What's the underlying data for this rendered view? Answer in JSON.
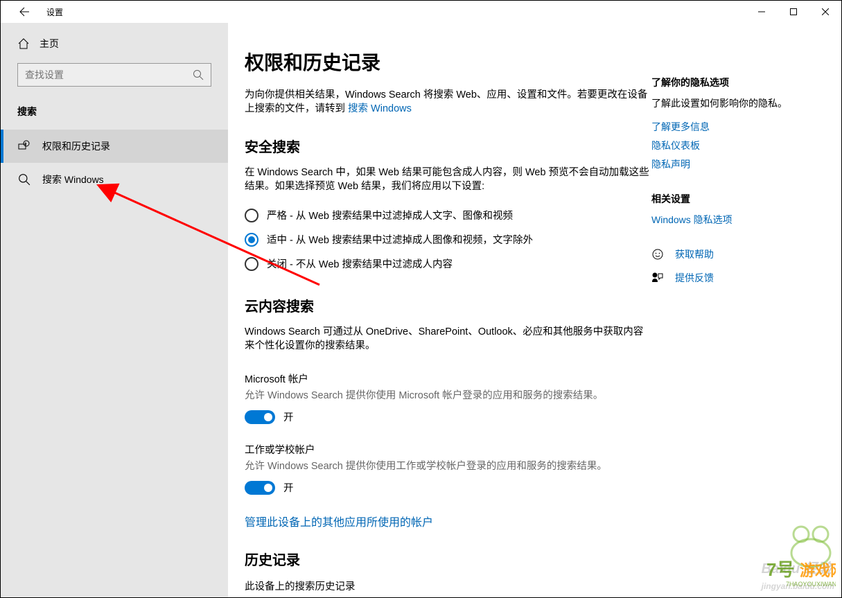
{
  "titlebar": {
    "title": "设置"
  },
  "sidebar": {
    "home": "主页",
    "search_placeholder": "查找设置",
    "section": "搜索",
    "items": [
      {
        "label": "权限和历史记录"
      },
      {
        "label": "搜索 Windows"
      }
    ]
  },
  "content": {
    "h1": "权限和历史记录",
    "intro": "为向你提供相关结果，Windows Search 将搜索 Web、应用、设置和文件。若要更改在设备上搜索的文件，请转到 ",
    "intro_link": "搜索 Windows",
    "safe": {
      "heading": "安全搜索",
      "desc": "在 Windows Search 中，如果 Web 结果可能包含成人内容，则 Web 预览不会自动加载这些结果。如果选择预览 Web 结果，我们将应用以下设置:",
      "options": [
        "严格 - 从 Web 搜索结果中过滤掉成人文字、图像和视频",
        "适中 - 从 Web 搜索结果中过滤掉成人图像和视频，文字除外",
        "关闭 - 不从 Web 搜索结果中过滤成人内容"
      ]
    },
    "cloud": {
      "heading": "云内容搜索",
      "desc": "Windows Search 可通过从 OneDrive、SharePoint、Outlook、必应和其他服务中获取内容来个性化设置你的搜索结果。",
      "ms_account": "Microsoft 帐户",
      "ms_desc": "允许 Windows Search 提供你使用 Microsoft 帐户登录的应用和服务的搜索结果。",
      "work_account": "工作或学校帐户",
      "work_desc": "允许 Windows Search 提供你使用工作或学校帐户登录的应用和服务的搜索结果。",
      "toggle_on": "开",
      "manage_link": "管理此设备上的其他应用所使用的帐户"
    },
    "history": {
      "heading": "历史记录",
      "sub": "此设备上的搜索历史记录"
    }
  },
  "side": {
    "privacy_heading": "了解你的隐私选项",
    "privacy_text": "了解此设置如何影响你的隐私。",
    "links1": [
      "了解更多信息",
      "隐私仪表板",
      "隐私声明"
    ],
    "related_heading": "相关设置",
    "related_link": "Windows 隐私选项",
    "help": "获取帮助",
    "feedback": "提供反馈"
  }
}
